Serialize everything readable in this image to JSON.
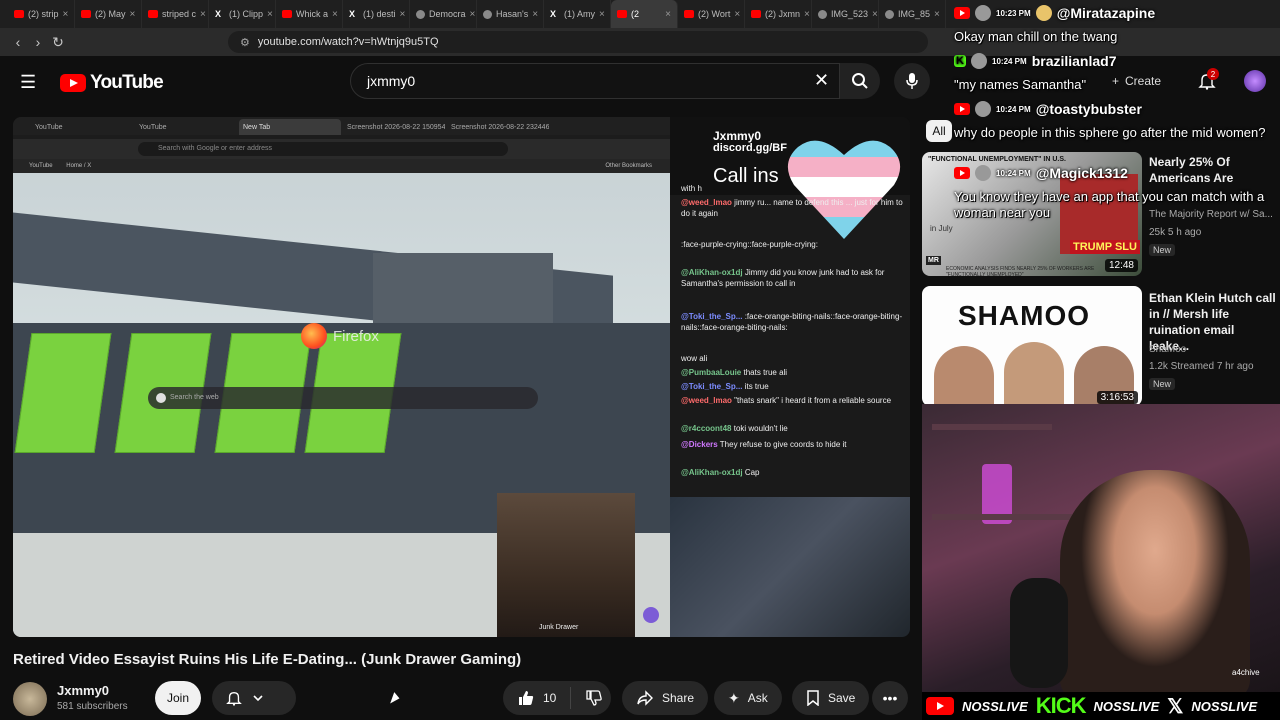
{
  "browser": {
    "tabs": [
      {
        "label": "(2) strip",
        "icon": "youtube-icon"
      },
      {
        "label": "(2) May",
        "icon": "youtube-icon"
      },
      {
        "label": "striped c",
        "icon": "youtube-icon"
      },
      {
        "label": "(1) Clipp",
        "icon": "x-icon"
      },
      {
        "label": "Whick a",
        "icon": "youtube-icon"
      },
      {
        "label": "(1) desti",
        "icon": "x-icon"
      },
      {
        "label": "Democra",
        "icon": "globe-icon"
      },
      {
        "label": "Hasan's",
        "icon": "globe-icon"
      },
      {
        "label": "(1) Amy",
        "icon": "x-icon"
      },
      {
        "label": "(2",
        "icon": "youtube-icon"
      },
      {
        "label": "(2) Wort",
        "icon": "youtube-icon"
      },
      {
        "label": "(2) Jxmn",
        "icon": "youtube-icon"
      },
      {
        "label": "IMG_523",
        "icon": "globe-icon"
      },
      {
        "label": "IMG_85",
        "icon": "globe-icon"
      }
    ],
    "url": "youtube.com/watch?v=hWtnjq9u5TQ"
  },
  "youtube": {
    "logo_text": "YouTube",
    "search_value": "jxmmy0",
    "create_label": "Create",
    "notif_count": "2",
    "chip_all": "All"
  },
  "video": {
    "inner_tabs": [
      "YouTube",
      "YouTube",
      "New Tab",
      "Screenshot 2026-08-22 150954.pn",
      "Screenshot 2026-08-22 232446.pn"
    ],
    "inner_url_placeholder": "Search with Google or enter address",
    "inner_bookmarks": [
      "YouTube",
      "Home / X"
    ],
    "inner_other_bookmarks": "Other Bookmarks",
    "firefox_word": "Firefox",
    "inner_search": "Search the web",
    "facecam_label": "Junk Drawer",
    "chat_header": {
      "name": "Jxmmy0",
      "discord": "discord.gg/BF",
      "call": "Call ins"
    },
    "chat_lines": [
      {
        "user": "",
        "text": "with h",
        "color": ""
      },
      {
        "user": "@weed_lmao",
        "text": "jimmy ru... name to defend this ... just for him to do it again",
        "color": "r"
      },
      {
        "user": "",
        "text": ":face-purple-crying::face-purple-crying:",
        "color": "b"
      },
      {
        "user": "@AliKhan-ox1dj",
        "text": "Jimmy did you know junk had to ask for Samantha's permission to call in",
        "color": "g"
      },
      {
        "user": "@Toki_the_Sp...",
        "text": ":face-orange-biting-nails::face-orange-biting-nails::face-orange-biting-nails:",
        "color": "b"
      },
      {
        "user": "",
        "text": "wow ali",
        "color": "b"
      },
      {
        "user": "@PumbaaLouie",
        "text": "thats true ali",
        "color": "g"
      },
      {
        "user": "@Toki_the_Sp...",
        "text": "its true",
        "color": "b"
      },
      {
        "user": "@weed_lmao",
        "text": "\"thats snark\" i heard it from a reliable source",
        "color": "r"
      },
      {
        "user": "@r4ccoont48",
        "text": "toki wouldn't lie",
        "color": "g"
      },
      {
        "user": "@Dickers",
        "text": "They refuse to give coords to hide it",
        "color": "p"
      },
      {
        "user": "@AliKhan-ox1dj",
        "text": "Cap",
        "color": "g"
      }
    ]
  },
  "video_info": {
    "title": "Retired Video Essayist Ruins His Life E-Dating... (Junk Drawer Gaming)",
    "channel": "Jxmmy0",
    "subscribers": "581 subscribers",
    "join_label": "Join",
    "like_count": "10",
    "share_label": "Share",
    "ask_label": "Ask",
    "save_label": "Save"
  },
  "recommendations": [
    {
      "title": "Nearly 25% Of Americans Are",
      "channel": "The Majority Report w/ Sa...",
      "meta": "25k  5 h ago",
      "badge": "New",
      "duration": "12:48",
      "thumb_text": "\"FUNCTIONAL UNEMPLOYMENT\" IN U.S.",
      "thumb_text2": "TRUMP SLU",
      "thumb_text3": "ECONOMIC ANALYSIS FINDS NEARLY 25% OF WORKERS ARE \"FUNCTIONALLY UNEMPLOYED\"",
      "thumb_text4": "in July",
      "thumb_text5": "MR"
    },
    {
      "title": "Ethan Klein Hutch call in // Mersh life ruination email leake...",
      "channel": "ShaMoo",
      "meta": "1.2k  Streamed 7 hr ago",
      "badge": "New",
      "duration": "3:16:53",
      "thumb_text": "SHAMOO"
    }
  ],
  "stream_overlay": {
    "messages": [
      {
        "time": "10:23 PM",
        "user": "@Miratazapine",
        "platform": "youtube",
        "text": "Okay man chill on the twang"
      },
      {
        "time": "10:24 PM",
        "user": "brazilianlad7",
        "platform": "kick",
        "text": "\"my names Samantha\""
      },
      {
        "time": "10:24 PM",
        "user": "@toastybubster",
        "platform": "youtube",
        "text": "why do people in this sphere go after the mid women?"
      },
      {
        "time": "10:24 PM",
        "user": "@Magick1312",
        "platform": "youtube",
        "text": "You know they have an app that you can match with a woman near you"
      }
    ],
    "watermark": "a4chive",
    "banner": [
      "NOSSLIVE",
      "NOSSLIVE",
      "NOSSLIVE"
    ],
    "kick_word": "KICK"
  }
}
